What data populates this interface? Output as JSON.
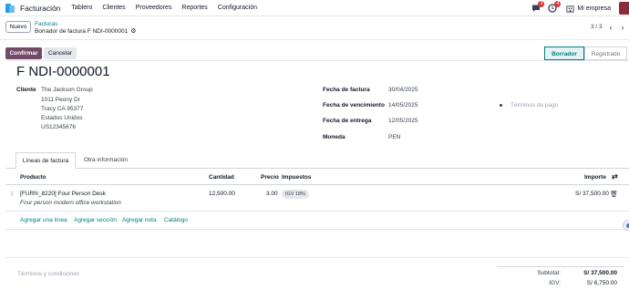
{
  "navbar": {
    "app_name": "Facturación",
    "menu": [
      "Tablero",
      "Clientes",
      "Proveedores",
      "Reportes",
      "Configuración"
    ],
    "messages_badge": "3",
    "activities_badge": "4",
    "company": "Mi empresa"
  },
  "control_panel": {
    "new_button": "Nuevo",
    "breadcrumb_parent": "Facturas",
    "breadcrumb_current": "Borrador de factura F NDI-0000001",
    "pager": "3 / 3"
  },
  "statusbar": {
    "confirm": "Confirmar",
    "cancel": "Cancelar",
    "stages": [
      "Borrador",
      "Registrado"
    ],
    "active_stage": "Borrador"
  },
  "invoice": {
    "title": "F NDI-0000001",
    "customer_label": "Cliente",
    "customer_name": "The Jackson Group",
    "address": [
      "1011 Peony Dr",
      "Tracy CA 95377",
      "Estados Unidos",
      "US12345676"
    ],
    "fields": [
      {
        "label": "Fecha de factura",
        "value": "30/04/2025"
      },
      {
        "label": "Fecha de vencimiento",
        "value": "14/05/2025"
      },
      {
        "label": "Fecha de entrega",
        "value": "12/05/2025"
      },
      {
        "label": "Moneda",
        "value": "PEN"
      }
    ],
    "payment_terms_placeholder": "Términos de pago"
  },
  "tabs": [
    "Líneas de factura",
    "Otra información"
  ],
  "table": {
    "headers": {
      "product": "Producto",
      "qty": "Cantidad",
      "price": "Precio",
      "taxes": "Impuestos",
      "amount": "Importe"
    },
    "rows": [
      {
        "product": "[FURN_8220] Four Person Desk",
        "description": "Four person modern office workstation",
        "qty": "12,500.00",
        "price": "3.00",
        "tax": "IGV 18%",
        "amount": "S/ 37,500.00"
      }
    ],
    "add_links": [
      "Agregar una línea",
      "Agregar sección",
      "Agregar nota",
      "Catálogo"
    ]
  },
  "footer": {
    "terms_placeholder": "Términos y condiciones",
    "subtotal_label": "Subtotal:",
    "subtotal_value": "S/ 37,500.00",
    "tax_label": "IGV:",
    "tax_value": "S/ 6,750.00"
  },
  "colors": {
    "brand": "#714b67",
    "link": "#017e84",
    "badge": "#d9363e"
  }
}
